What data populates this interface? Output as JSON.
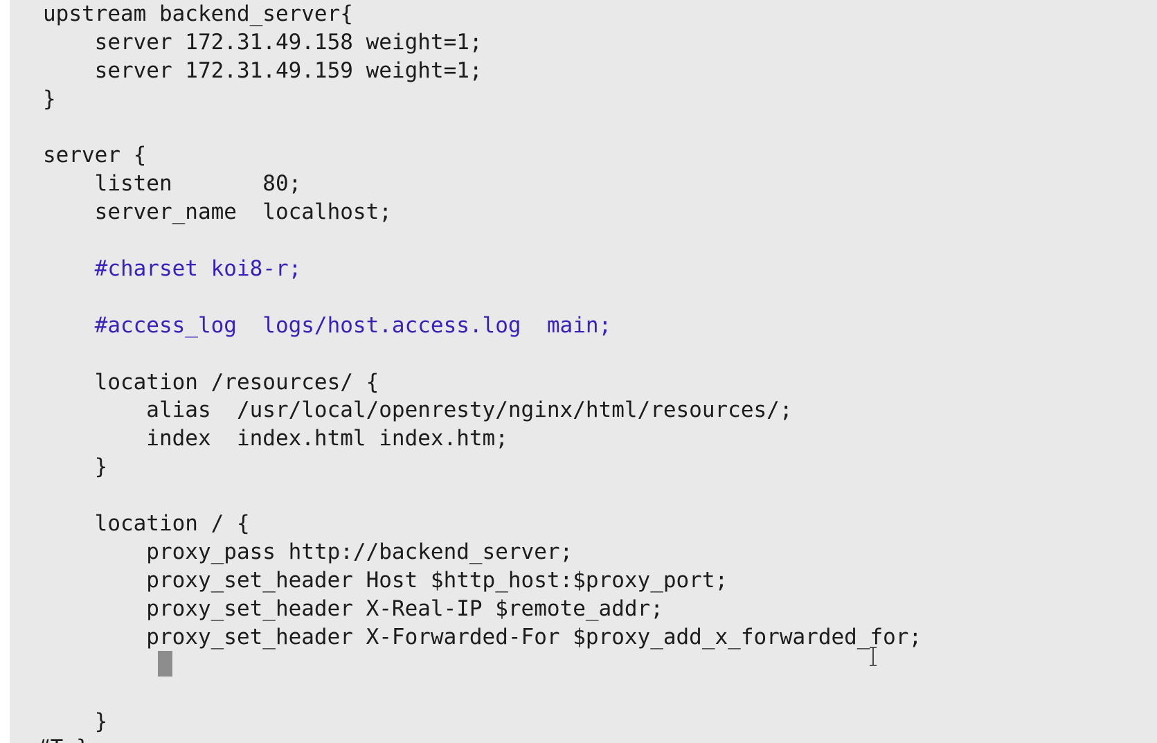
{
  "editor": {
    "lines": [
      {
        "text": "upstream backend_server{",
        "kind": "code"
      },
      {
        "text": "    server 172.31.49.158 weight=1;",
        "kind": "code"
      },
      {
        "text": "    server 172.31.49.159 weight=1;",
        "kind": "code"
      },
      {
        "text": "}",
        "kind": "code"
      },
      {
        "text": "",
        "kind": "blank"
      },
      {
        "text": "server {",
        "kind": "code"
      },
      {
        "text": "    listen       80;",
        "kind": "code"
      },
      {
        "text": "    server_name  localhost;",
        "kind": "code"
      },
      {
        "text": "",
        "kind": "blank"
      },
      {
        "text": "    #charset koi8-r;",
        "kind": "comment"
      },
      {
        "text": "",
        "kind": "blank"
      },
      {
        "text": "    #access_log  logs/host.access.log  main;",
        "kind": "comment"
      },
      {
        "text": "",
        "kind": "blank"
      },
      {
        "text": "    location /resources/ {",
        "kind": "code"
      },
      {
        "text": "        alias  /usr/local/openresty/nginx/html/resources/;",
        "kind": "code"
      },
      {
        "text": "        index  index.html index.htm;",
        "kind": "code"
      },
      {
        "text": "    }",
        "kind": "code"
      },
      {
        "text": "",
        "kind": "blank"
      },
      {
        "text": "    location / {",
        "kind": "code"
      },
      {
        "text": "        proxy_pass http://backend_server;",
        "kind": "code"
      },
      {
        "text": "        proxy_set_header Host $http_host:$proxy_port;",
        "kind": "code"
      },
      {
        "text": "        proxy_set_header X-Real-IP $remote_addr;",
        "kind": "code"
      },
      {
        "text": "        proxy_set_header X-Forwarded-For $proxy_add_x_forwarded_for;",
        "kind": "code"
      },
      {
        "text": "",
        "kind": "cursor-line"
      },
      {
        "text": "",
        "kind": "blank"
      },
      {
        "text": "    }",
        "kind": "code"
      }
    ],
    "cutoff_text": "#T }",
    "colors": {
      "background": "#e9e9e9",
      "text": "#1c1c1c",
      "comment": "#3a21b8",
      "cursor": "#8d8d8d"
    },
    "cursor_icon": "text-cursor-ibeam-icon"
  }
}
